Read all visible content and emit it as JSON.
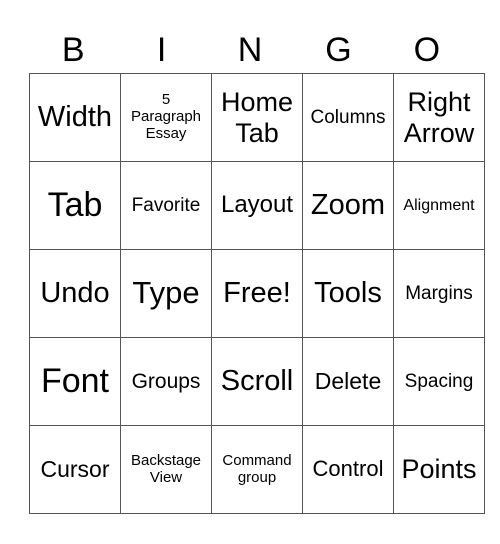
{
  "header": [
    "B",
    "I",
    "N",
    "G",
    "O"
  ],
  "cells": [
    [
      "Width",
      "5\nParagraph\nEssay",
      "Home Tab",
      "Columns",
      "Right Arrow"
    ],
    [
      "Tab",
      "Favorite",
      "Layout",
      "Zoom",
      "Alignment"
    ],
    [
      "Undo",
      "Type",
      "Free!",
      "Tools",
      "Margins"
    ],
    [
      "Font",
      "Groups",
      "Scroll",
      "Delete",
      "Spacing"
    ],
    [
      "Cursor",
      "Backstage View",
      "Command group",
      "Control",
      "Points"
    ]
  ]
}
